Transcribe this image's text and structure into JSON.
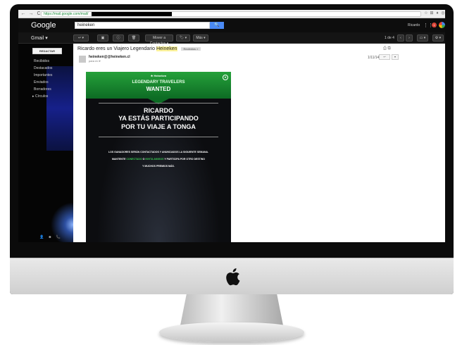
{
  "browser": {
    "url": "https://mail.google.com/mail/",
    "nav": [
      "←",
      "→",
      "C"
    ],
    "ext_icons": [
      "☆",
      "⊞",
      "♦",
      "◎",
      "✎",
      "≡"
    ]
  },
  "header": {
    "logo": "Google",
    "search_value": "heineken",
    "search_icon": "🔍",
    "user": "Ricardo",
    "apps_icon": "⋮⋮⋮",
    "notifications": "1"
  },
  "toolbar": {
    "gmail_label": "Gmail ▾",
    "buttons": [
      "↩ ▾",
      "▣",
      "ⓘ",
      "🗑",
      "Mover a Contactos ▾",
      "🏷 ▾",
      "Más ▾"
    ],
    "pager": "1 de 4",
    "prev": "‹",
    "next": "›",
    "view_btn": "▭ ▾",
    "settings_btn": "⚙ ▾"
  },
  "sidebar": {
    "compose": "REDACTAR",
    "folders": [
      "Recibidos",
      "Destacados",
      "Importantes",
      "Enviados",
      "Borradores",
      "▸ Círculos"
    ],
    "footer": [
      "👤",
      "☻",
      "📞"
    ]
  },
  "mail": {
    "subject_prefix": "Ricardo eres un Viajero Legendario ",
    "subject_highlight": "Heineken",
    "inbox_tag": "Recibidos ×",
    "print_icons": "⎙ ⧉",
    "sender": "heineken@@heineken.cl",
    "to": "para mí ▾",
    "date": "1/11/14",
    "reply": "↩",
    "more": "▾"
  },
  "campaign": {
    "brand": "★ Heineken",
    "badge": "★",
    "head_line1": "LEGENDARY TRAVELERS",
    "head_line2": "WANTED",
    "name": "RICARDO",
    "participating": "YA ESTÁS PARTICIPANDO",
    "trip": "POR TU VIAJE A TONGA",
    "line1": "LOS GANADORES SERÁN CONTACTADOS Y ANUNCIADOS LA SIGUIENTE SEMANA.",
    "line2_a": "MANTENTE ",
    "line2_b": "CONECTADO",
    "line2_c": " O ",
    "line2_d": "INVITA AMIGOS",
    "line2_e": " Y PARTICIPA POR OTRO DESTINO",
    "line3": "Y MUCHOS PREMIOS MÁS."
  }
}
